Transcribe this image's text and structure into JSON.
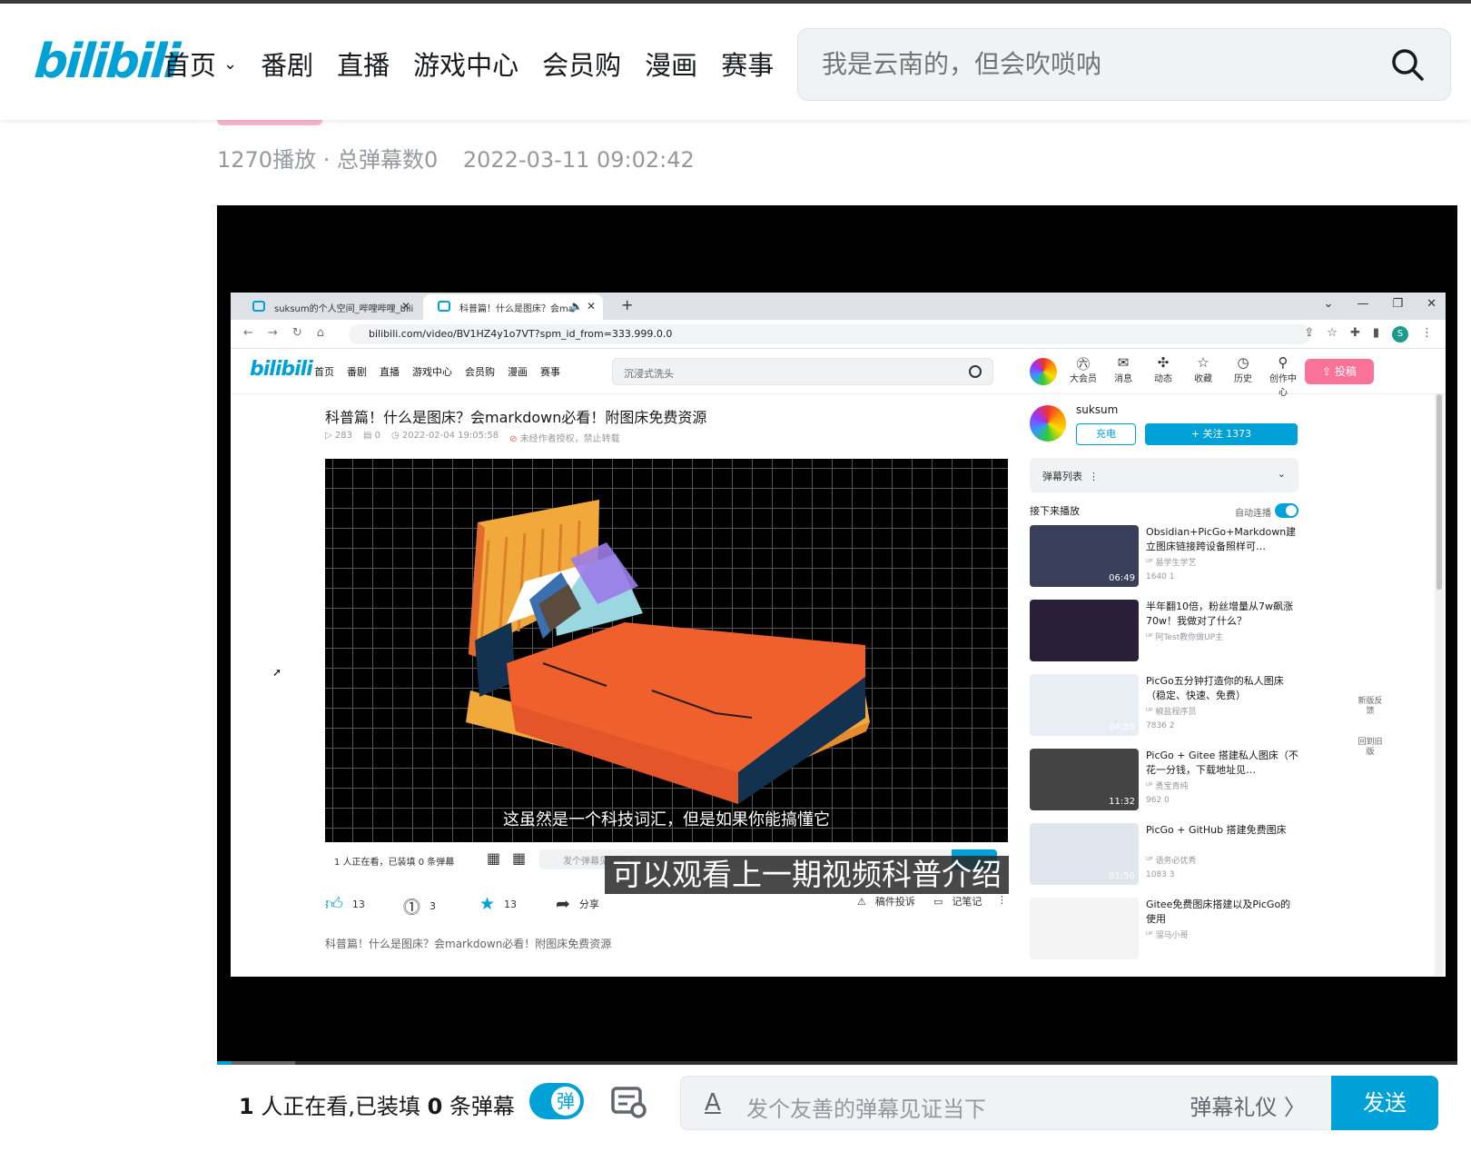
{
  "header": {
    "logo": "bilibili",
    "nav": [
      "首页",
      "番剧",
      "直播",
      "游戏中心",
      "会员购",
      "漫画",
      "赛事"
    ],
    "search_placeholder": "我是云南的，但会吹唢呐"
  },
  "video": {
    "meta_plays": "1270播放 · 总弹幕数0",
    "meta_date": "2022-03-11 09:02:42"
  },
  "inner": {
    "tabs": [
      "suksum的个人空间_哔哩哔哩_bili",
      "科普篇！什么是图床？会ma"
    ],
    "url": "bilibili.com/video/BV1HZ4y1o7VT?spm_id_from=333.999.0.0",
    "avatar_letter": "S",
    "logo": "bilibili",
    "nav": [
      "首页",
      "番剧",
      "直播",
      "游戏中心",
      "会员购",
      "漫画",
      "赛事"
    ],
    "search": "沉浸式洗头",
    "icons": [
      "大会员",
      "消息",
      "动态",
      "收藏",
      "历史",
      "创作中心"
    ],
    "upload": "投稿",
    "title": "科普篇！什么是图床？会markdown必看！附图床免费资源",
    "plays": "283",
    "danmaku": "0",
    "date": "2022-02-04 19:05:58",
    "warning": "未经作者授权，禁止转载",
    "subtitle": "这虽然是一个科技词汇，但是如果你能搞懂它",
    "watching": "1 人正在看，已装填 0 条弹幕",
    "dm_placeholder": "发个弹幕见证当下",
    "likes": "13",
    "coins": "3",
    "favs": "13",
    "share": "分享",
    "report": "稿件投诉",
    "notes": "记笔记",
    "bottom_text": "科普篇！什么是图床？会markdown必看！附图床免费资源",
    "up_name": "suksum",
    "charge": "充电",
    "follow": "+ 关注 1373",
    "dm_list": "弹幕列表",
    "next_play": "接下来播放",
    "autoplay": "自动连播",
    "feedback": "新版反馈",
    "old": "回到旧版",
    "recs": [
      {
        "title": "Obsidian+PicGo+Markdown建立图床链接跨设备照样可…",
        "author": "易学生学艺",
        "stats": "1640   1",
        "dur": "06:49",
        "color": "#3a3f5c"
      },
      {
        "title": "半年翻10倍，粉丝增量从7w飙涨70w！我做对了什么？",
        "author": "阿Test教你做UP主",
        "stats": "",
        "dur": "",
        "color": "#2a1f38"
      },
      {
        "title": "PicGo五分钟打造你的私人图床（稳定、快速、免费）",
        "author": "椒盐程序员",
        "stats": "7836   2",
        "dur": "04:55",
        "color": "#e8eef3"
      },
      {
        "title": "PicGo + Gitee 搭建私人图床（不花一分钱，下载地址见…",
        "author": "勇宝青纯",
        "stats": "962   0",
        "dur": "11:32",
        "color": "#444"
      },
      {
        "title": "PicGo + GitHub 搭建免费图床",
        "author": "语务必优秀",
        "stats": "1083   3",
        "dur": "01:50",
        "color": "#dfe6ee"
      },
      {
        "title": "Gitee免费图床搭建以及PicGo的使用",
        "author": "溜马小哥",
        "stats": "",
        "dur": "",
        "color": "#f4f4f4"
      }
    ]
  },
  "overlay_caption": "可以观看上一期视频科普介绍",
  "bottom": {
    "watching_num": "1",
    "watching_mid": " 人正在看,已装填 ",
    "dm_num": "0",
    "watching_end": " 条弹幕",
    "toggle": "弹",
    "placeholder": "发个友善的弹幕见证当下",
    "etiquette": "弹幕礼仪 〉",
    "send": "发送"
  }
}
